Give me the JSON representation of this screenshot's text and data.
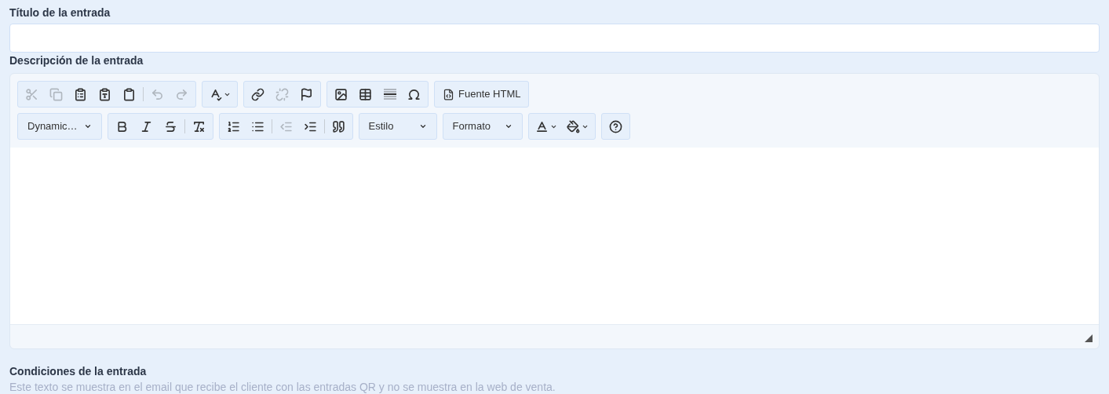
{
  "title_field": {
    "label": "Título de la entrada"
  },
  "description": {
    "label": "Descripción de la entrada",
    "toolbar_rows": [
      [
        {
          "items": [
            {
              "kind": "cut",
              "disabled": true
            },
            {
              "kind": "copy",
              "disabled": true
            },
            {
              "kind": "paste",
              "disabled": false
            },
            {
              "kind": "pastetext",
              "disabled": false
            },
            {
              "kind": "pasteword",
              "disabled": false
            },
            {
              "kind": "separator"
            },
            {
              "kind": "undo",
              "disabled": true
            },
            {
              "kind": "redo",
              "disabled": true
            }
          ]
        },
        {
          "items": [
            {
              "kind": "spellcheck",
              "disabled": false
            }
          ]
        },
        {
          "items": [
            {
              "kind": "link",
              "disabled": false
            },
            {
              "kind": "unlink",
              "disabled": true
            },
            {
              "kind": "anchor",
              "disabled": false
            }
          ]
        },
        {
          "items": [
            {
              "kind": "image",
              "disabled": false
            },
            {
              "kind": "table",
              "disabled": false
            },
            {
              "kind": "rule",
              "disabled": false
            },
            {
              "kind": "symbol",
              "disabled": false
            }
          ]
        },
        {
          "items": [
            {
              "kind": "source",
              "label": "Fuente HTML",
              "disabled": false
            }
          ]
        }
      ],
      [
        {
          "items": [
            {
              "kind": "dropdown",
              "label": "Dynamic…",
              "disabled": false
            }
          ]
        },
        {
          "items": [
            {
              "kind": "bold",
              "disabled": false
            },
            {
              "kind": "italic",
              "disabled": false
            },
            {
              "kind": "strike",
              "disabled": false
            },
            {
              "kind": "separator"
            },
            {
              "kind": "clearformat",
              "disabled": false
            }
          ]
        },
        {
          "items": [
            {
              "kind": "numbered",
              "disabled": false
            },
            {
              "kind": "bulleted",
              "disabled": false
            },
            {
              "kind": "separator"
            },
            {
              "kind": "outdent",
              "disabled": true
            },
            {
              "kind": "indent",
              "disabled": false
            },
            {
              "kind": "separator"
            },
            {
              "kind": "quote",
              "disabled": false
            }
          ]
        },
        {
          "items": [
            {
              "kind": "dropdown",
              "label": "Estilo",
              "disabled": false
            }
          ]
        },
        {
          "items": [
            {
              "kind": "dropdown",
              "label": "Formato",
              "disabled": false
            }
          ]
        },
        {
          "items": [
            {
              "kind": "textcolor",
              "disabled": false
            },
            {
              "kind": "bgcolor",
              "disabled": false
            }
          ]
        },
        {
          "items": [
            {
              "kind": "help",
              "disabled": false
            }
          ]
        }
      ]
    ]
  },
  "conditions": {
    "label": "Condiciones de la entrada",
    "hint": "Este texto se muestra en el email que recibe el cliente con las entradas QR y no se muestra en la web de venta."
  }
}
